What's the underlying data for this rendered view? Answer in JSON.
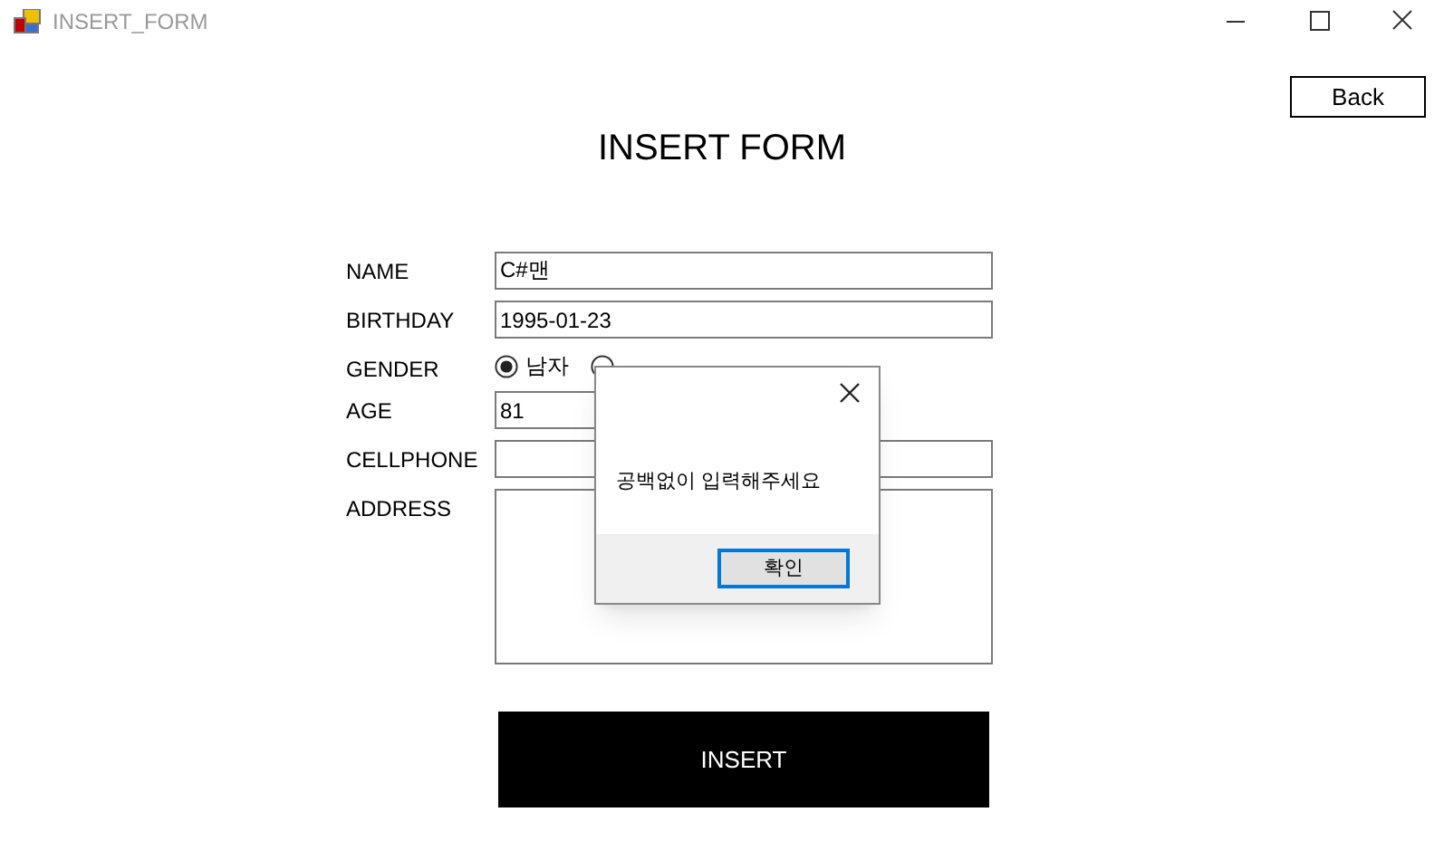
{
  "window": {
    "title": "INSERT_FORM"
  },
  "back_button": "Back",
  "heading": "INSERT FORM",
  "fields": [
    {
      "kind": "text",
      "label": "NAME",
      "value": "C#맨"
    },
    {
      "kind": "text",
      "label": "BIRTHDAY",
      "value": "1995-01-23"
    },
    {
      "kind": "radio",
      "label": "GENDER",
      "options": [
        {
          "label": "남자",
          "selected": true
        },
        {
          "selected": false
        }
      ]
    },
    {
      "kind": "short",
      "label": "AGE",
      "value": "81"
    },
    {
      "kind": "text",
      "label": "CELLPHONE"
    },
    {
      "kind": "area",
      "label": "ADDRESS"
    }
  ],
  "insert_button": "INSERT",
  "dialog": {
    "message": "공백없이 입력해주세요",
    "button": "확인"
  }
}
